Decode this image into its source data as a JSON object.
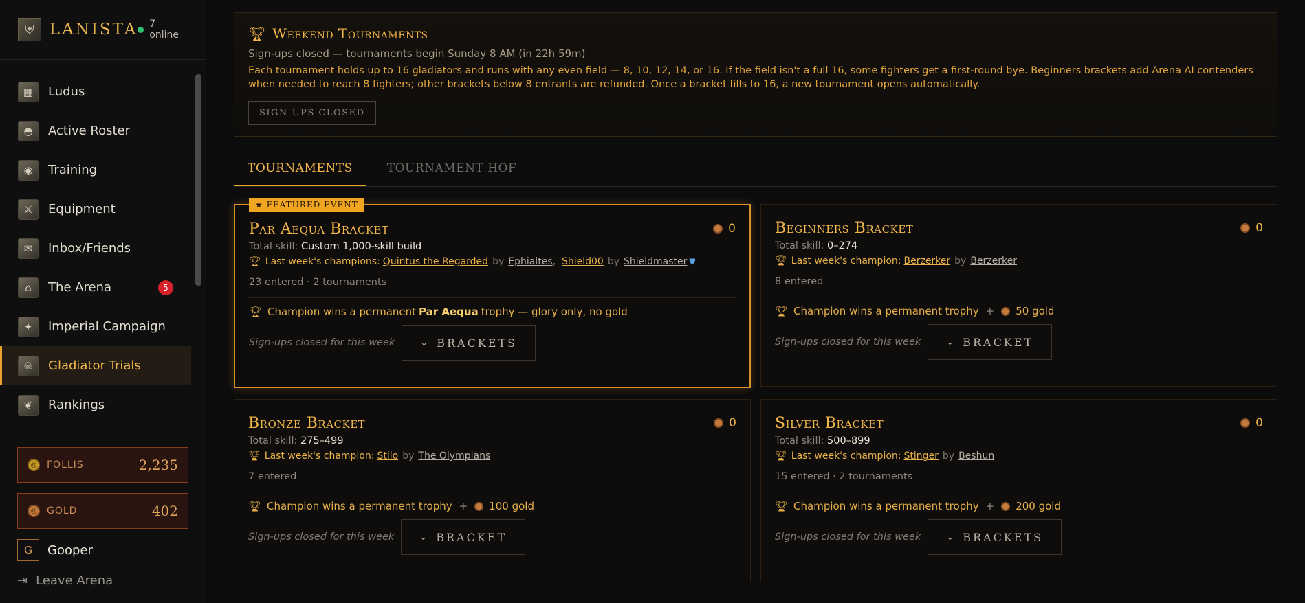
{
  "brand": {
    "name": "LANISTA",
    "online_text": "7 online"
  },
  "nav": [
    {
      "label": "Ludus",
      "icon": "ludus-icon"
    },
    {
      "label": "Active Roster",
      "icon": "helmet-icon"
    },
    {
      "label": "Training",
      "icon": "shield-icon"
    },
    {
      "label": "Equipment",
      "icon": "sword-icon"
    },
    {
      "label": "Inbox/Friends",
      "icon": "inbox-icon"
    },
    {
      "label": "The Arena",
      "icon": "colosseum-icon",
      "badge": "5"
    },
    {
      "label": "Imperial Campaign",
      "icon": "map-icon"
    },
    {
      "label": "Gladiator Trials",
      "icon": "skull-icon",
      "active": true
    },
    {
      "label": "Rankings",
      "icon": "laurel-icon"
    }
  ],
  "currency": {
    "follis": {
      "label": "FOLLIS",
      "value": "2,235"
    },
    "gold": {
      "label": "GOLD",
      "value": "402"
    }
  },
  "user": {
    "initial": "G",
    "name": "Gooper"
  },
  "leave": {
    "label": "Leave Arena"
  },
  "banner": {
    "title": "Weekend Tournaments",
    "subtitle": "Sign-ups closed — tournaments begin Sunday 8 AM (in 22h 59m)",
    "description": "Each tournament holds up to 16 gladiators and runs with any even field — 8, 10, 12, 14, or 16. If the field isn't a full 16, some fighters get a first-round bye. Beginners brackets add Arena AI contenders when needed to reach 8 fighters; other brackets below 8 entrants are refunded. Once a bracket fills to 16, a new tournament opens automatically.",
    "button": "SIGN-UPS CLOSED"
  },
  "tabs": [
    "TOURNAMENTS",
    "TOURNAMENT HOF"
  ],
  "cards": {
    "par_aequa": {
      "tag": "★ FEATURED EVENT",
      "title": "Par Aequa Bracket",
      "count": "0",
      "skill_label": "Total skill:",
      "skill_value": "Custom 1,000-skill build",
      "champ_label": "Last week's champions:",
      "champ1": "Quintus the Regarded",
      "by1": "by",
      "owner1": "Ephialtes",
      "champ2": "Shield00",
      "by2": "by",
      "owner2": "Shieldmaster",
      "entered": "23 entered · 2 tournaments",
      "prize_pre": "Champion wins a permanent",
      "prize_bold": "Par Aequa",
      "prize_post": "trophy — glory only, no gold",
      "closed": "Sign-ups closed for this week",
      "button": "BRACKETS"
    },
    "beginners": {
      "title": "Beginners Bracket",
      "count": "0",
      "skill_label": "Total skill:",
      "skill_value": "0–274",
      "champ_label": "Last week's champion:",
      "champ": "Berzerker",
      "by": "by",
      "owner": "Berzerker",
      "entered": "8 entered",
      "prize": "Champion wins a permanent trophy",
      "plus": "+",
      "gold": "50 gold",
      "closed": "Sign-ups closed for this week",
      "button": "BRACKET"
    },
    "bronze": {
      "title": "Bronze Bracket",
      "count": "0",
      "skill_label": "Total skill:",
      "skill_value": "275–499",
      "champ_label": "Last week's champion:",
      "champ": "Stilo",
      "by": "by",
      "owner": "The Olympians",
      "entered": "7 entered",
      "prize": "Champion wins a permanent trophy",
      "plus": "+",
      "gold": "100 gold",
      "closed": "Sign-ups closed for this week",
      "button": "BRACKET"
    },
    "silver": {
      "title": "Silver Bracket",
      "count": "0",
      "skill_label": "Total skill:",
      "skill_value": "500–899",
      "champ_label": "Last week's champion:",
      "champ": "Stinger",
      "by": "by",
      "owner": "Beshun",
      "entered": "15 entered · 2 tournaments",
      "prize": "Champion wins a permanent trophy",
      "plus": "+",
      "gold": "200 gold",
      "closed": "Sign-ups closed for this week",
      "button": "BRACKETS"
    }
  }
}
